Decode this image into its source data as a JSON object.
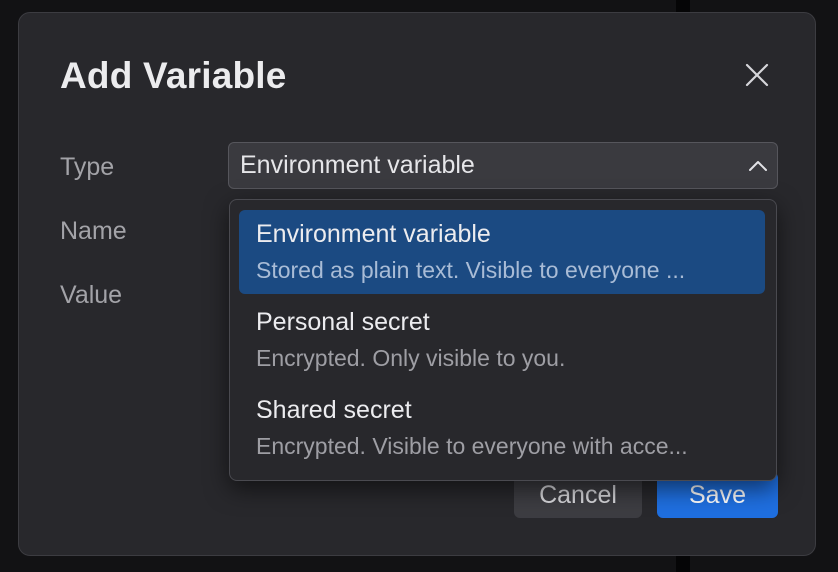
{
  "dialog": {
    "title": "Add Variable",
    "close_icon": "close-icon"
  },
  "form": {
    "type_label": "Type",
    "name_label": "Name",
    "value_label": "Value",
    "type_select": {
      "value": "Environment variable",
      "chevron_icon": "chevron-up-icon",
      "expanded": true
    }
  },
  "dropdown": {
    "options": [
      {
        "title": "Environment variable",
        "description": "Stored as plain text. Visible to everyone ...",
        "selected": true
      },
      {
        "title": "Personal secret",
        "description": "Encrypted. Only visible to you.",
        "selected": false
      },
      {
        "title": "Shared secret",
        "description": "Encrypted. Visible to everyone with acce...",
        "selected": false
      }
    ]
  },
  "footer": {
    "cancel_label": "Cancel",
    "save_label": "Save"
  },
  "colors": {
    "accent": "#1f6fe0",
    "selected_option": "#1b4a82",
    "dialog_bg": "#28282c"
  }
}
